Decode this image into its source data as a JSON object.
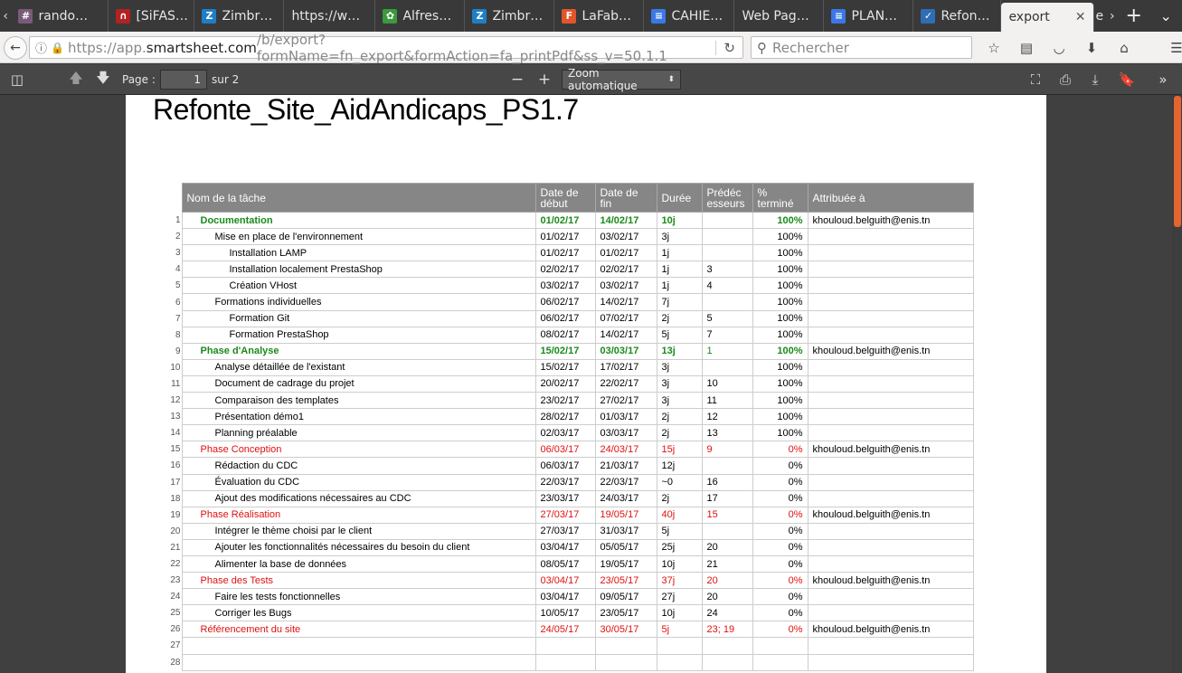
{
  "tabs": [
    {
      "label": "rando…",
      "icon": "hash-icon",
      "color": "#7a5a7a"
    },
    {
      "label": "[SiFAS…",
      "icon": "arch-icon",
      "color": "#b22222"
    },
    {
      "label": "Zimbr…",
      "icon": "zimbra-icon",
      "color": "#1e7fc7"
    },
    {
      "label": "https://w…",
      "icon": "",
      "color": ""
    },
    {
      "label": "Alfres…",
      "icon": "alfresco-icon",
      "color": "#3b9a3b"
    },
    {
      "label": "Zimbr…",
      "icon": "zimbra-icon",
      "color": "#1e7fc7"
    },
    {
      "label": "LaFab…",
      "icon": "f-icon",
      "color": "#e2542a"
    },
    {
      "label": "CAHIE…",
      "icon": "docs-icon",
      "color": "#3b78e7"
    },
    {
      "label": "Web Pag…",
      "icon": "",
      "color": ""
    },
    {
      "label": "PLAN…",
      "icon": "docs-icon",
      "color": "#3b78e7"
    },
    {
      "label": "Refon…",
      "icon": "check-icon",
      "color": "#2f6db5"
    }
  ],
  "active_tab": {
    "label": "export"
  },
  "overflow_tab": "e",
  "nav": {
    "url_prefix": "https://app.",
    "url_host": "smartsheet.com",
    "url_rest": "/b/export?formName=fn_export&formAction=fa_printPdf&ss_v=50.1.1",
    "search_placeholder": "Rechercher"
  },
  "pdf": {
    "page_label": "Page :",
    "page_value": "1",
    "page_total": "sur 2",
    "zoom_label": "Zoom automatique",
    "zoom_minus": "−",
    "zoom_plus": "+"
  },
  "document": {
    "title": "Refonte_Site_AidAndicaps_PS1.7",
    "headers": {
      "name": "Nom de la tâche",
      "start": "Date de début",
      "end": "Date de fin",
      "duration": "Durée",
      "pred": "Prédéc esseurs",
      "pct": "% terminé",
      "assign": "Attribuée à"
    },
    "rows": [
      {
        "n": "1",
        "name": "Documentation",
        "start": "01/02/17",
        "end": "14/02/17",
        "dur": "10j",
        "pred": "",
        "pct": "100%",
        "assign": "khouloud.belguith@enis.tn",
        "level": 0,
        "style": "green"
      },
      {
        "n": "2",
        "name": "Mise en place de l'environnement",
        "start": "01/02/17",
        "end": "03/02/17",
        "dur": "3j",
        "pred": "",
        "pct": "100%",
        "assign": "",
        "level": 1,
        "style": ""
      },
      {
        "n": "3",
        "name": "Installation LAMP",
        "start": "01/02/17",
        "end": "01/02/17",
        "dur": "1j",
        "pred": "",
        "pct": "100%",
        "assign": "",
        "level": 2,
        "style": ""
      },
      {
        "n": "4",
        "name": "Installation localement PrestaShop",
        "start": "02/02/17",
        "end": "02/02/17",
        "dur": "1j",
        "pred": "3",
        "pct": "100%",
        "assign": "",
        "level": 2,
        "style": ""
      },
      {
        "n": "5",
        "name": "Création VHost",
        "start": "03/02/17",
        "end": "03/02/17",
        "dur": "1j",
        "pred": "4",
        "pct": "100%",
        "assign": "",
        "level": 2,
        "style": ""
      },
      {
        "n": "6",
        "name": "Formations individuelles",
        "start": "06/02/17",
        "end": "14/02/17",
        "dur": "7j",
        "pred": "",
        "pct": "100%",
        "assign": "",
        "level": 1,
        "style": ""
      },
      {
        "n": "7",
        "name": "Formation Git",
        "start": "06/02/17",
        "end": "07/02/17",
        "dur": "2j",
        "pred": "5",
        "pct": "100%",
        "assign": "",
        "level": 2,
        "style": ""
      },
      {
        "n": "8",
        "name": "Formation PrestaShop",
        "start": "08/02/17",
        "end": "14/02/17",
        "dur": "5j",
        "pred": "7",
        "pct": "100%",
        "assign": "",
        "level": 2,
        "style": ""
      },
      {
        "n": "9",
        "name": "Phase d'Analyse",
        "start": "15/02/17",
        "end": "03/03/17",
        "dur": "13j",
        "pred": "1",
        "pct": "100%",
        "assign": "khouloud.belguith@enis.tn",
        "level": 0,
        "style": "green"
      },
      {
        "n": "10",
        "name": "Analyse détaillée de l'existant",
        "start": "15/02/17",
        "end": "17/02/17",
        "dur": "3j",
        "pred": "",
        "pct": "100%",
        "assign": "",
        "level": 1,
        "style": ""
      },
      {
        "n": "11",
        "name": "Document de cadrage du projet",
        "start": "20/02/17",
        "end": "22/02/17",
        "dur": "3j",
        "pred": "10",
        "pct": "100%",
        "assign": "",
        "level": 1,
        "style": ""
      },
      {
        "n": "12",
        "name": "Comparaison des templates",
        "start": "23/02/17",
        "end": "27/02/17",
        "dur": "3j",
        "pred": "11",
        "pct": "100%",
        "assign": "",
        "level": 1,
        "style": ""
      },
      {
        "n": "13",
        "name": "Présentation démo1",
        "start": "28/02/17",
        "end": "01/03/17",
        "dur": "2j",
        "pred": "12",
        "pct": "100%",
        "assign": "",
        "level": 1,
        "style": ""
      },
      {
        "n": "14",
        "name": "Planning préalable",
        "start": "02/03/17",
        "end": "03/03/17",
        "dur": "2j",
        "pred": "13",
        "pct": "100%",
        "assign": "",
        "level": 1,
        "style": ""
      },
      {
        "n": "15",
        "name": "Phase Conception",
        "start": "06/03/17",
        "end": "24/03/17",
        "dur": "15j",
        "pred": "9",
        "pct": "0%",
        "assign": "khouloud.belguith@enis.tn",
        "level": 0,
        "style": "red"
      },
      {
        "n": "16",
        "name": "Rédaction du CDC",
        "start": "06/03/17",
        "end": "21/03/17",
        "dur": "12j",
        "pred": "",
        "pct": "0%",
        "assign": "",
        "level": 1,
        "style": ""
      },
      {
        "n": "17",
        "name": "Évaluation du CDC",
        "start": "22/03/17",
        "end": "22/03/17",
        "dur": "~0",
        "pred": "16",
        "pct": "0%",
        "assign": "",
        "level": 1,
        "style": ""
      },
      {
        "n": "18",
        "name": "Ajout des modifications nécessaires au CDC",
        "start": "23/03/17",
        "end": "24/03/17",
        "dur": "2j",
        "pred": "17",
        "pct": "0%",
        "assign": "",
        "level": 1,
        "style": ""
      },
      {
        "n": "19",
        "name": "Phase Réalisation",
        "start": "27/03/17",
        "end": "19/05/17",
        "dur": "40j",
        "pred": "15",
        "pct": "0%",
        "assign": "khouloud.belguith@enis.tn",
        "level": 0,
        "style": "red"
      },
      {
        "n": "20",
        "name": "Intégrer le thème choisi par le client",
        "start": "27/03/17",
        "end": "31/03/17",
        "dur": "5j",
        "pred": "",
        "pct": "0%",
        "assign": "",
        "level": 1,
        "style": ""
      },
      {
        "n": "21",
        "name": "Ajouter les fonctionnalités nécessaires du besoin du client",
        "start": "03/04/17",
        "end": "05/05/17",
        "dur": "25j",
        "pred": "20",
        "pct": "0%",
        "assign": "",
        "level": 1,
        "style": ""
      },
      {
        "n": "22",
        "name": "Alimenter la base de données",
        "start": "08/05/17",
        "end": "19/05/17",
        "dur": "10j",
        "pred": "21",
        "pct": "0%",
        "assign": "",
        "level": 1,
        "style": ""
      },
      {
        "n": "23",
        "name": "Phase des Tests",
        "start": "03/04/17",
        "end": "23/05/17",
        "dur": "37j",
        "pred": "20",
        "pct": "0%",
        "assign": "khouloud.belguith@enis.tn",
        "level": 0,
        "style": "red"
      },
      {
        "n": "24",
        "name": "Faire les tests fonctionnelles",
        "start": "03/04/17",
        "end": "09/05/17",
        "dur": "27j",
        "pred": "20",
        "pct": "0%",
        "assign": "",
        "level": 1,
        "style": ""
      },
      {
        "n": "25",
        "name": "Corriger les Bugs",
        "start": "10/05/17",
        "end": "23/05/17",
        "dur": "10j",
        "pred": "24",
        "pct": "0%",
        "assign": "",
        "level": 1,
        "style": ""
      },
      {
        "n": "26",
        "name": "Référencement du site",
        "start": "24/05/17",
        "end": "30/05/17",
        "dur": "5j",
        "pred": "23; 19",
        "pct": "0%",
        "assign": "khouloud.belguith@enis.tn",
        "level": 0,
        "style": "red"
      },
      {
        "n": "27",
        "name": "",
        "start": "",
        "end": "",
        "dur": "",
        "pred": "",
        "pct": "",
        "assign": "",
        "level": 0,
        "style": ""
      },
      {
        "n": "28",
        "name": "",
        "start": "",
        "end": "",
        "dur": "",
        "pred": "",
        "pct": "",
        "assign": "",
        "level": 0,
        "style": ""
      }
    ]
  }
}
